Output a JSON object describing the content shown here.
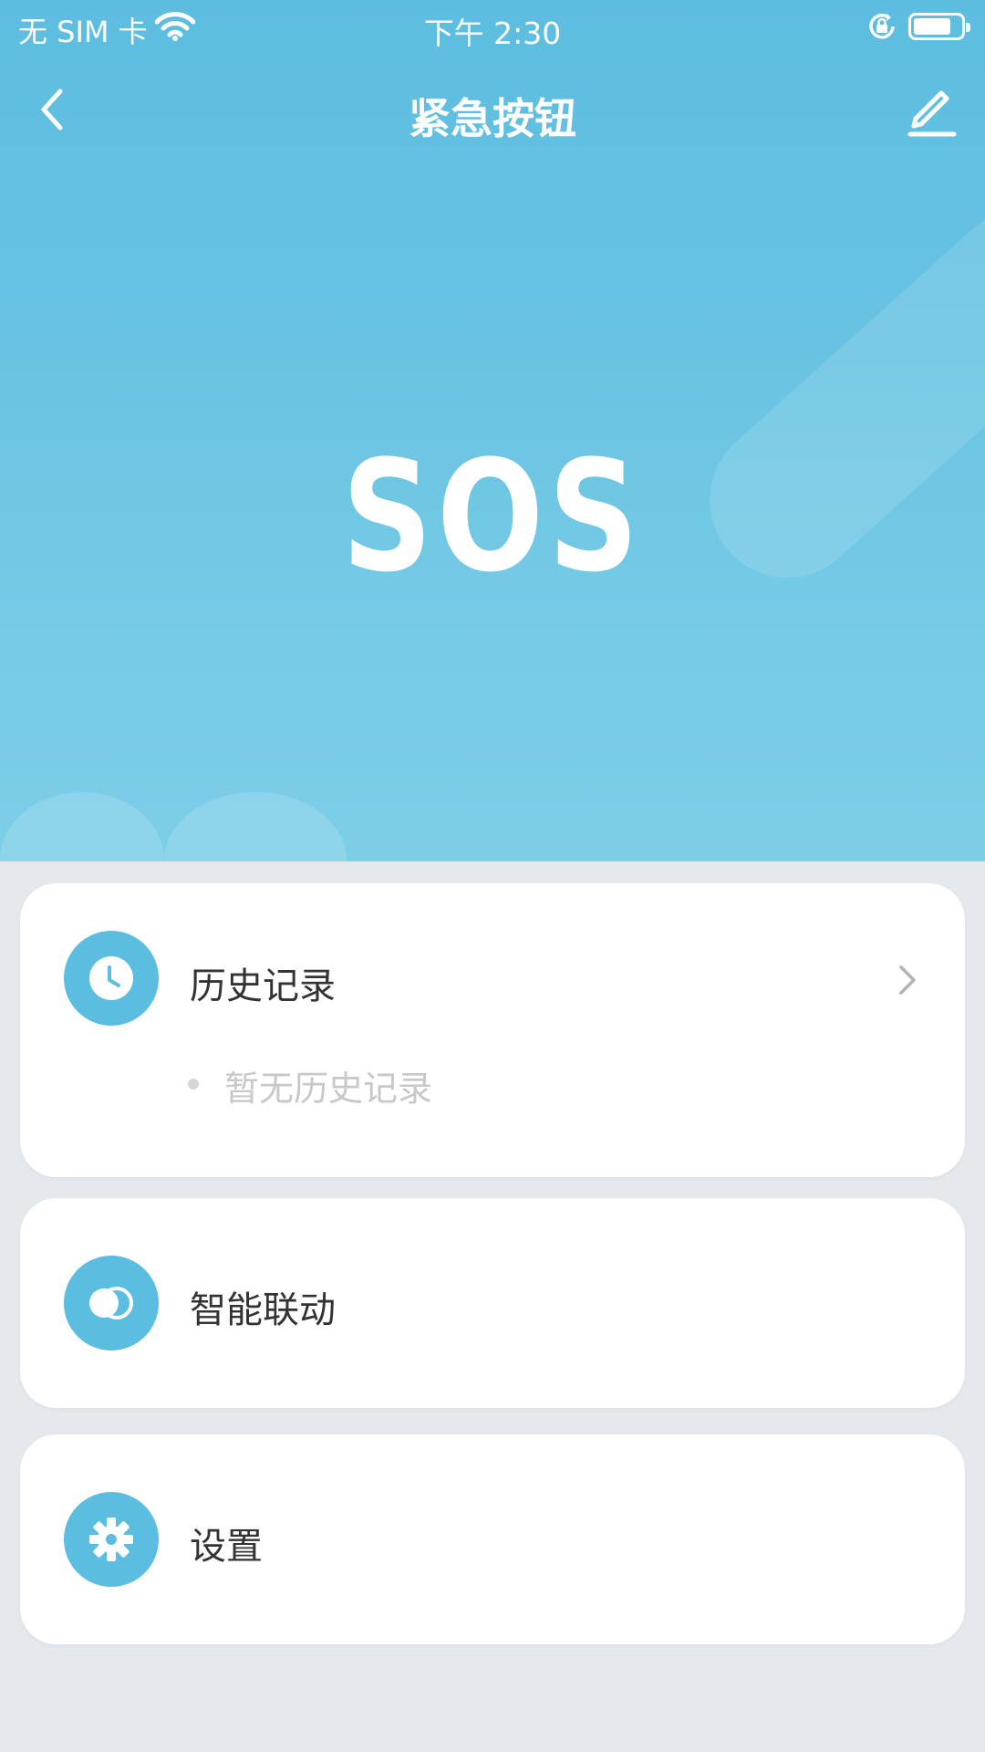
{
  "status_bar": {
    "carrier": "无 SIM 卡",
    "time": "下午 2:30",
    "icons": [
      "wifi-icon",
      "orientation-lock-icon",
      "battery-icon"
    ]
  },
  "nav": {
    "title": "紧急按钮",
    "icons": [
      "back-arrow-icon",
      "edit-pencil-icon"
    ]
  },
  "hero": {
    "big_text": "SOS"
  },
  "cards": {
    "history": {
      "label": "历史记录",
      "empty_text": "暂无历史记录",
      "icon": "clock-icon"
    },
    "linkage": {
      "label": "智能联动",
      "icon": "toggle-icon"
    },
    "settings": {
      "label": "设置",
      "icon": "gear-icon"
    }
  },
  "colors": {
    "hero_top": "#5dbde0",
    "hero_bottom": "#7dcee7",
    "accent": "#5bbde0",
    "page_background": "#e3e9ec",
    "card_background": "#ffffff"
  }
}
